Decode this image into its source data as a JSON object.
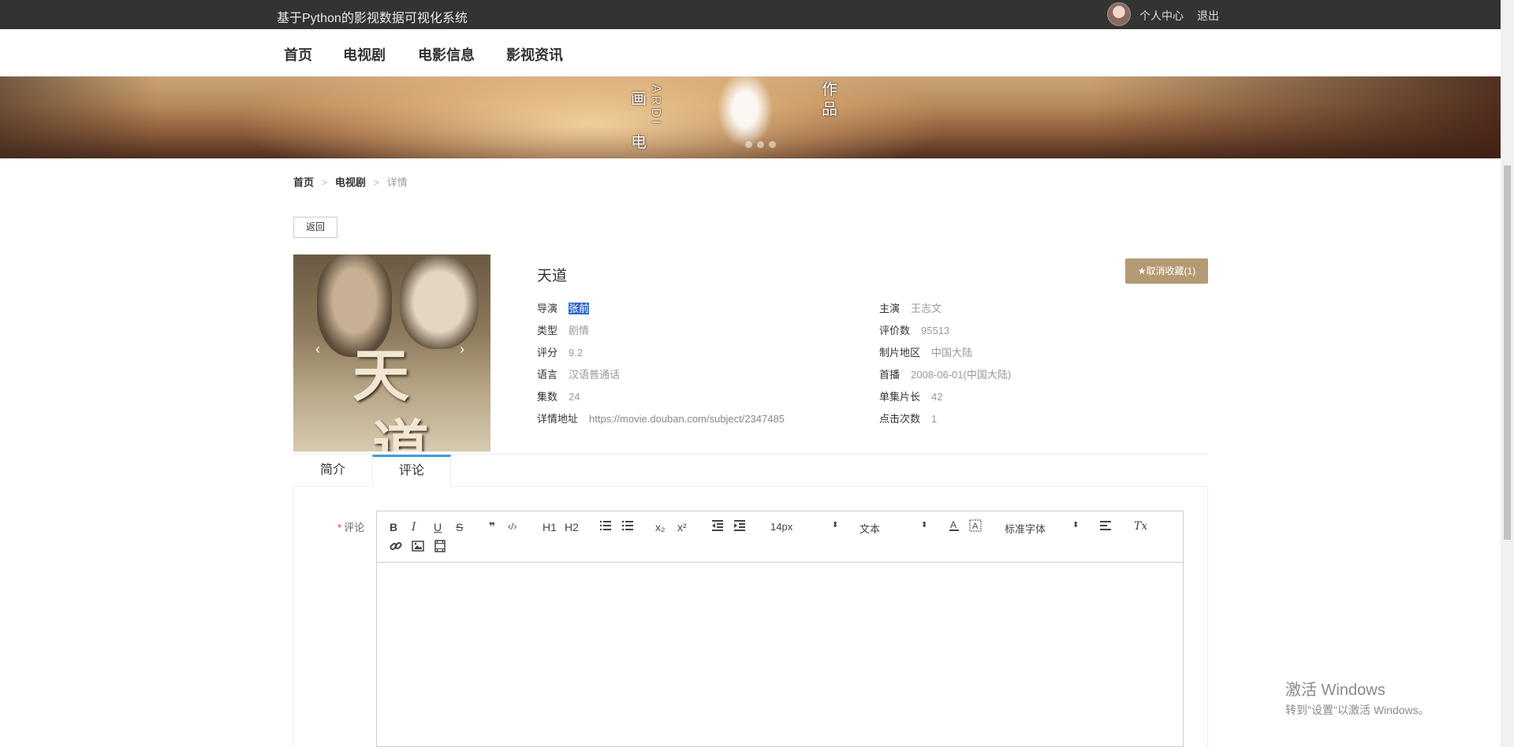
{
  "header": {
    "app_title": "基于Python的影视数据可视化系统",
    "user_center": "个人中心",
    "logout": "退出"
  },
  "nav": [
    "首页",
    "电视剧",
    "电影信息",
    "影视资讯"
  ],
  "banner": {
    "glyphs": [
      "画",
      "电",
      "作",
      "品",
      "ARDI"
    ]
  },
  "breadcrumb": {
    "home": "首页",
    "separator": ">",
    "category": "电视剧",
    "current": "详情"
  },
  "back_button": "返回",
  "poster": {
    "title_chars": [
      "天",
      "道"
    ],
    "prev_arrow": "‹",
    "next_arrow": "›"
  },
  "show": {
    "title": "天道",
    "favorite_button": "★取消收藏(1)"
  },
  "details": {
    "director_label": "导演",
    "director_value": "张前",
    "actor_label": "主演",
    "actor_value": "王志文",
    "genre_label": "类型",
    "genre_value": "剧情",
    "reviews_label": "评价数",
    "reviews_value": "95513",
    "score_label": "评分",
    "score_value": "9.2",
    "region_label": "制片地区",
    "region_value": "中国大陆",
    "language_label": "语言",
    "language_value": "汉语普通话",
    "premiere_label": "首播",
    "premiere_value": "2008-06-01(中国大陆)",
    "episodes_label": "集数",
    "episodes_value": "24",
    "episode_length_label": "单集片长",
    "episode_length_value": "42",
    "url_label": "详情地址",
    "url_value": "https://movie.douban.com/subject/2347485",
    "clicks_label": "点击次数",
    "clicks_value": "1"
  },
  "tabs": {
    "intro": "简介",
    "comments": "评论",
    "active": "评论"
  },
  "comment_form": {
    "required_mark": "*",
    "label": "评论",
    "font_size": "14px",
    "text_type": "文本",
    "font_family": "标准字体",
    "h1": "H1",
    "h2": "H2",
    "bold": "B",
    "italic": "I",
    "underline": "U",
    "strike": "S",
    "quote": "❞",
    "code": "‹/›",
    "sub": "x₂",
    "sup": "x²",
    "clear": "Tx"
  },
  "watermark": {
    "line1": "激活 Windows",
    "line2": "转到\"设置\"以激活 Windows。"
  }
}
